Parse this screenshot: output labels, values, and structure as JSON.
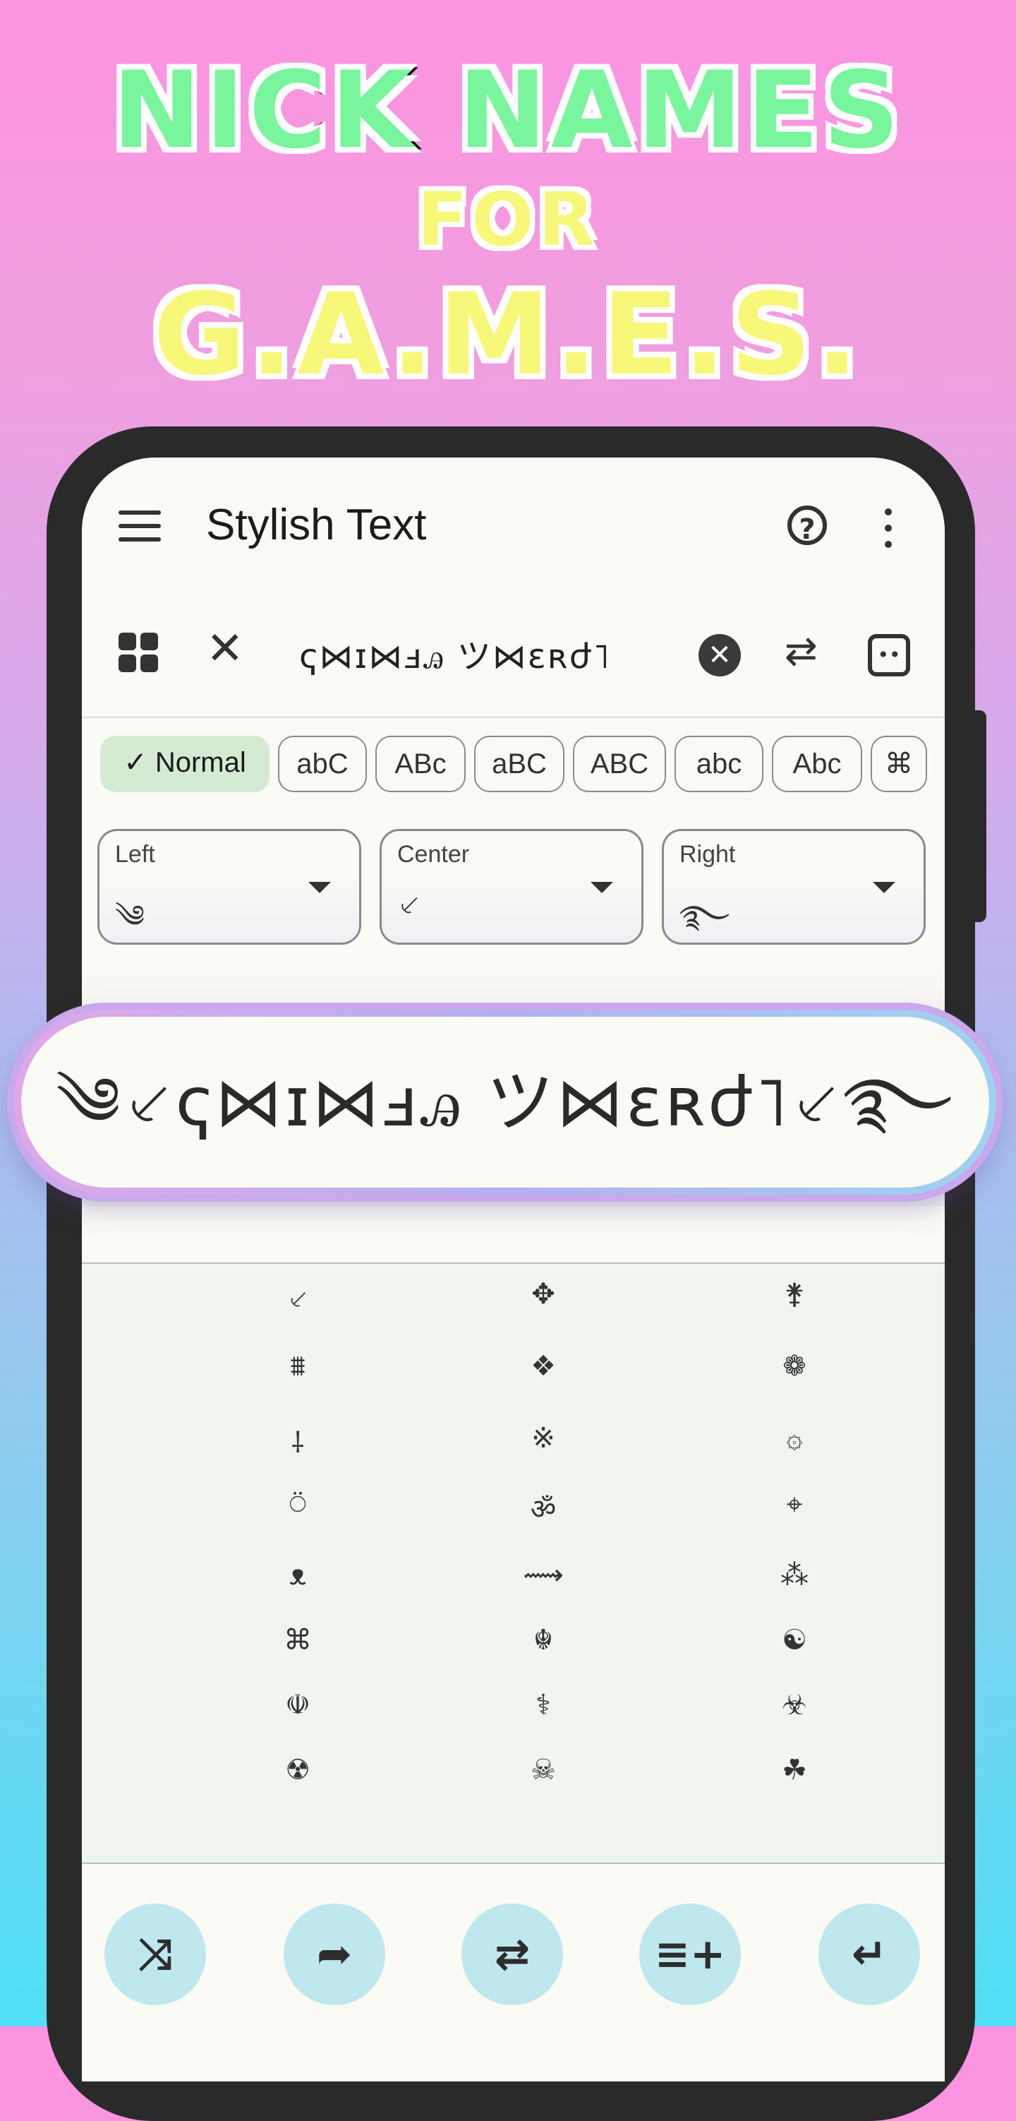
{
  "headline": {
    "line1": "NICK NAMES",
    "line2": "FOR",
    "line3": "G.A.M.E.S."
  },
  "appbar": {
    "title": "Stylish Text",
    "help_glyph": "?"
  },
  "input": {
    "text": "ҁ⋈ɪ⋈ⅎꭿ ツ⋈ɛʀժ˥",
    "clear_glyph": "✕",
    "close_glyph": "✕",
    "swap_glyph": "⇄",
    "emoji_glyph": "••"
  },
  "chips": [
    {
      "label": "✓  Normal",
      "selected": true
    },
    {
      "label": "abC"
    },
    {
      "label": "ABc"
    },
    {
      "label": "aBC"
    },
    {
      "label": "ABC"
    },
    {
      "label": "abc"
    },
    {
      "label": "Abc"
    },
    {
      "label": "⌘"
    }
  ],
  "dropdowns": [
    {
      "label": "Left",
      "value": "༄"
    },
    {
      "label": "Center",
      "value": "⸔"
    },
    {
      "label": "Right",
      "value": "࿐"
    }
  ],
  "preview": {
    "text": "༄⸔ҁ⋈ɪ⋈ⅎꭿ ツ⋈ɛʀժ˥⸔࿐"
  },
  "symbols": [
    [
      "⸔",
      "✥",
      "⚵"
    ],
    [
      "⩩",
      "❖",
      "❁"
    ],
    [
      "⸸",
      "※",
      "۞"
    ],
    [
      "⍥",
      "ॐ",
      "⌖"
    ],
    [
      "ᴥ",
      "⟿",
      "⁂"
    ],
    [
      "⌘",
      "☬",
      "☯"
    ],
    [
      "☫",
      "⚕",
      "☣"
    ],
    [
      "☢",
      "☠",
      "☘"
    ]
  ],
  "fabs": [
    {
      "name": "shuffle",
      "glyph": "⤨"
    },
    {
      "name": "share",
      "glyph": "➦"
    },
    {
      "name": "repeat",
      "glyph": "⇄"
    },
    {
      "name": "add-to-list",
      "glyph": "≡+"
    },
    {
      "name": "enter",
      "glyph": "↵"
    }
  ]
}
